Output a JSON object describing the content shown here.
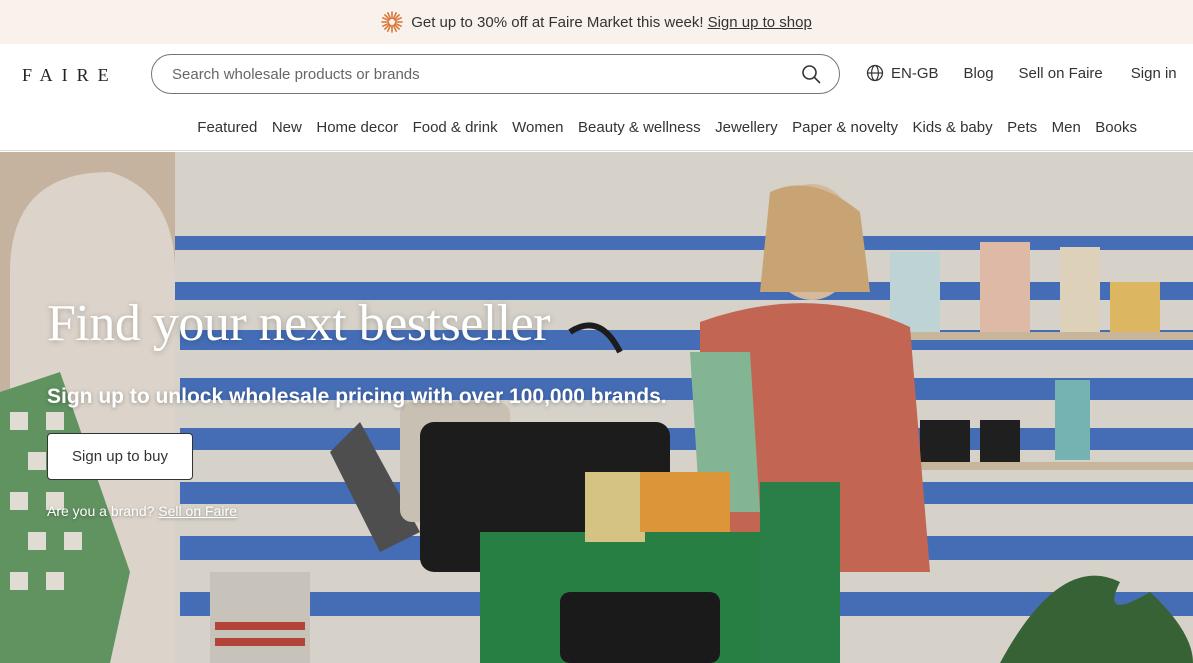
{
  "promo": {
    "text": "Get up to 30% off at Faire Market this week!",
    "link": "Sign up to shop",
    "icon": "sunburst-icon"
  },
  "header": {
    "logo": "FAIRE",
    "search_placeholder": "Search wholesale products or brands",
    "language": "EN-GB",
    "blog": "Blog",
    "sell": "Sell on Faire",
    "sign_in": "Sign in"
  },
  "categories": [
    "Featured",
    "New",
    "Home decor",
    "Food & drink",
    "Women",
    "Beauty & wellness",
    "Jewellery",
    "Paper & novelty",
    "Kids & baby",
    "Pets",
    "Men",
    "Books"
  ],
  "hero": {
    "title": "Find your next bestseller",
    "subtitle": "Sign up to unlock wholesale pricing with over 100,000 brands.",
    "button": "Sign up to buy",
    "brand_prompt": "Are you a brand?",
    "brand_link": "Sell on Faire"
  },
  "colors": {
    "promo_bg": "#f8f1ec",
    "accent_orange": "#d9773a",
    "stripe_blue": "#3b6cc4"
  }
}
